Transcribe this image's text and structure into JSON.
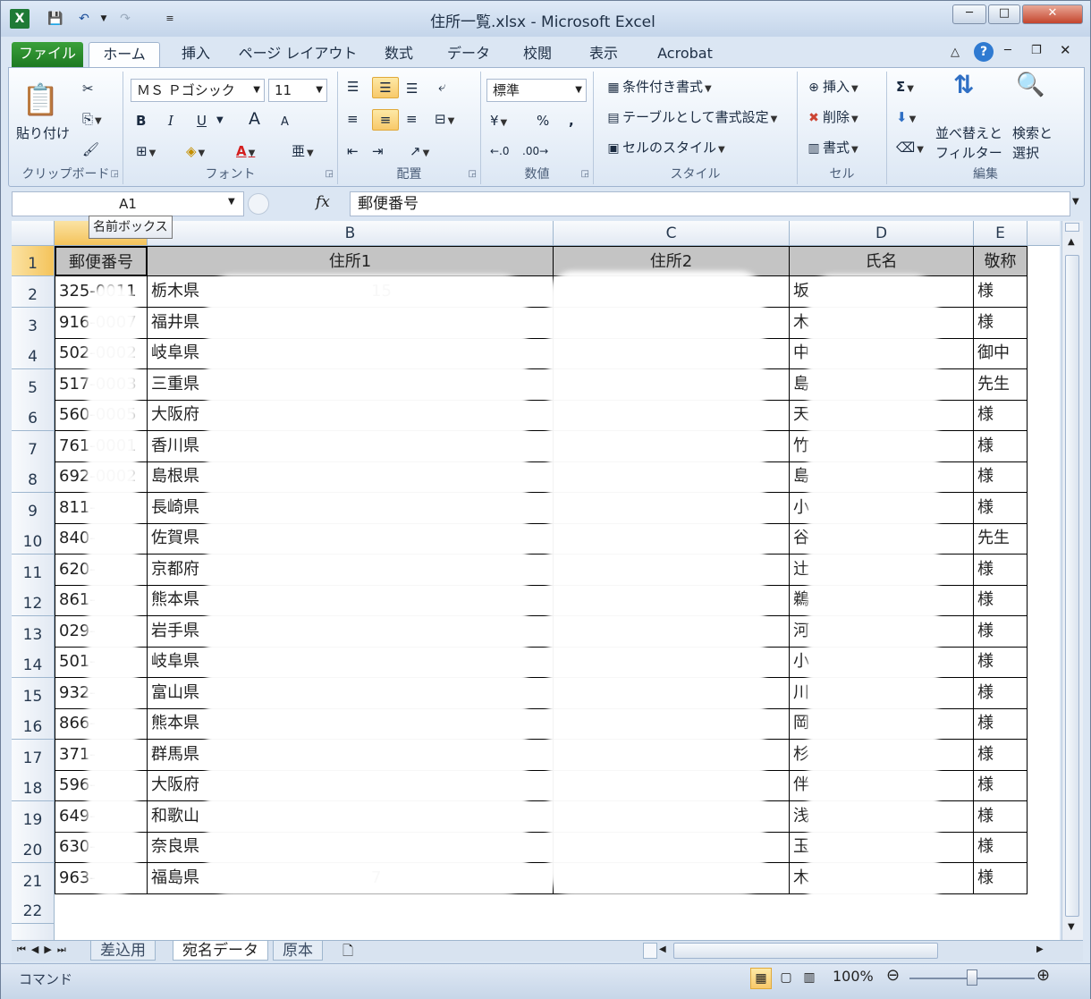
{
  "window": {
    "title": "住所一覧.xlsx - Microsoft Excel",
    "controls": [
      "─",
      "□",
      "✕"
    ]
  },
  "ribbon_tabs": [
    "ファイル",
    "ホーム",
    "挿入",
    "ページ レイアウト",
    "数式",
    "データ",
    "校閲",
    "表示",
    "Acrobat"
  ],
  "clipboard": {
    "paste": "貼り付け",
    "label": "クリップボード"
  },
  "font": {
    "name": "ＭＳ Ｐゴシック",
    "size": "11",
    "bold": "B",
    "italic": "I",
    "underline": "U",
    "grow": "A",
    "shrink": "A",
    "label": "フォント"
  },
  "alignment": {
    "label": "配置"
  },
  "number": {
    "format": "標準",
    "percent": "%",
    "comma": ",",
    "label": "数値"
  },
  "styles": {
    "conditional": "条件付き書式",
    "table": "テーブルとして書式設定",
    "cell": "セルのスタイル",
    "label": "スタイル"
  },
  "cells": {
    "insert": "挿入",
    "delete": "削除",
    "format": "書式",
    "label": "セル"
  },
  "editing": {
    "sort1": "並べ替えと",
    "sort2": "フィルター",
    "find1": "検索と",
    "find2": "選択",
    "label": "編集"
  },
  "formula_bar": {
    "name_box": "A1",
    "fx": "fx",
    "content": "郵便番号",
    "tooltip": "名前ボックス"
  },
  "columns": [
    "A",
    "B",
    "C",
    "D",
    "E"
  ],
  "header_row": [
    "郵便番号",
    "住所1",
    "住所2",
    "氏名",
    "敬称"
  ],
  "rows": [
    {
      "n": "2",
      "zip": "325-0011",
      "pref": "栃木県",
      "addr1_tail": "15",
      "name_head": "坂",
      "honor": "様"
    },
    {
      "n": "3",
      "zip": "916-0007",
      "pref": "福井県",
      "addr1_tail": "",
      "name_head": "木",
      "honor": "様"
    },
    {
      "n": "4",
      "zip": "502-0002",
      "pref": "岐阜県",
      "addr1_tail": "",
      "name_head": "中",
      "honor": "御中"
    },
    {
      "n": "5",
      "zip": "517-0003",
      "pref": "三重県",
      "addr1_tail": "",
      "name_head": "島",
      "honor": "先生"
    },
    {
      "n": "6",
      "zip": "560-0005",
      "pref": "大阪府",
      "addr1_tail": "",
      "name_head": "天",
      "honor": "様"
    },
    {
      "n": "7",
      "zip": "761-0001",
      "pref": "香川県",
      "addr1_tail": "",
      "name_head": "竹",
      "honor": "様"
    },
    {
      "n": "8",
      "zip": "692-0002",
      "pref": "島根県",
      "addr1_tail": "",
      "name_head": "島",
      "honor": "様"
    },
    {
      "n": "9",
      "zip": "811-",
      "pref": "長崎県",
      "addr1_tail": "",
      "name_head": "小",
      "honor": "様"
    },
    {
      "n": "10",
      "zip": "840-",
      "pref": "佐賀県",
      "addr1_tail": "",
      "name_head": "谷",
      "honor": "先生"
    },
    {
      "n": "11",
      "zip": "620-",
      "pref": "京都府",
      "addr1_tail": "",
      "name_head": "辻",
      "honor": "様"
    },
    {
      "n": "12",
      "zip": "861-",
      "pref": "熊本県",
      "addr1_tail": "",
      "name_head": "鵜",
      "honor": "様"
    },
    {
      "n": "13",
      "zip": "029-",
      "pref": "岩手県",
      "addr1_tail": "",
      "name_head": "河",
      "honor": "様"
    },
    {
      "n": "14",
      "zip": "501-",
      "pref": "岐阜県",
      "addr1_tail": "",
      "name_head": "小",
      "honor": "様"
    },
    {
      "n": "15",
      "zip": "932-",
      "pref": "富山県",
      "addr1_tail": "",
      "name_head": "川",
      "honor": "様"
    },
    {
      "n": "16",
      "zip": "866-",
      "pref": "熊本県",
      "addr1_tail": "",
      "name_head": "岡",
      "honor": "様"
    },
    {
      "n": "17",
      "zip": "371-",
      "pref": "群馬県",
      "addr1_tail": "",
      "name_head": "杉",
      "honor": "様"
    },
    {
      "n": "18",
      "zip": "596-",
      "pref": "大阪府",
      "addr1_tail": "",
      "name_head": "伴",
      "honor": "様"
    },
    {
      "n": "19",
      "zip": "649-",
      "pref": "和歌山",
      "addr1_tail": "",
      "name_head": "浅",
      "honor": "様"
    },
    {
      "n": "20",
      "zip": "630-",
      "pref": "奈良県",
      "addr1_tail": "",
      "name_head": "玉",
      "honor": "様"
    },
    {
      "n": "21",
      "zip": "963-",
      "pref": "福島県",
      "addr1_tail": "7",
      "name_head": "木",
      "honor": "様"
    }
  ],
  "row_numbers_extra": [
    "1",
    "22"
  ],
  "sheet_tabs": [
    "差込用",
    "宛名データ",
    "原本"
  ],
  "status": {
    "mode": "コマンド",
    "zoom": "100%"
  }
}
